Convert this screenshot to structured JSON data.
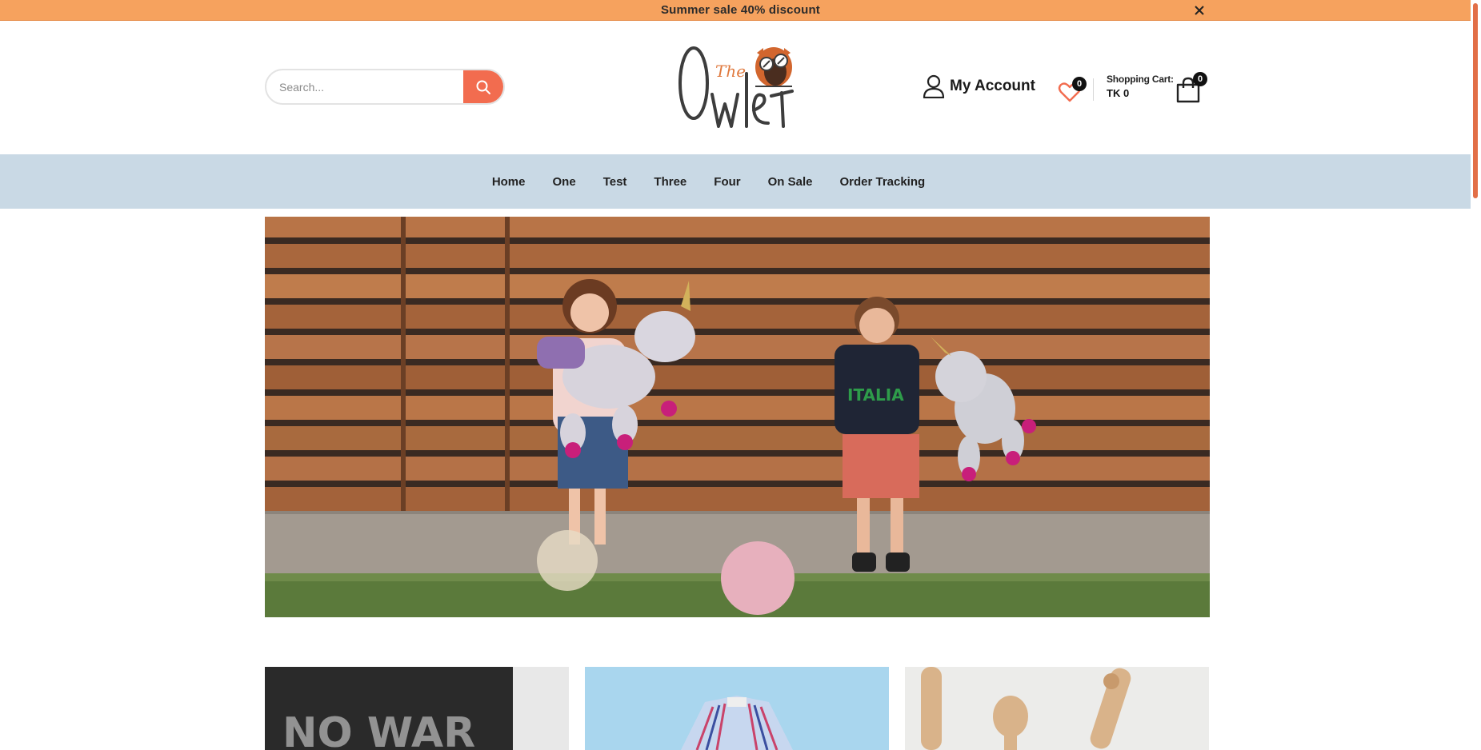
{
  "announcement": {
    "text": "Summer sale 40% discount"
  },
  "header": {
    "search": {
      "placeholder": "Search..."
    },
    "logo": {
      "small_text": "The",
      "main_text": "Owlet"
    },
    "account": {
      "label": "My Account"
    },
    "wishlist": {
      "count": "0"
    },
    "cart": {
      "title": "Shopping Cart:",
      "total": "TK 0",
      "count": "0"
    }
  },
  "nav": {
    "items": [
      {
        "label": "Home"
      },
      {
        "label": "One"
      },
      {
        "label": "Test"
      },
      {
        "label": "Three"
      },
      {
        "label": "Four"
      },
      {
        "label": "On Sale"
      },
      {
        "label": "Order Tracking"
      }
    ]
  },
  "cards": {
    "card1_text": "NO WAR"
  },
  "colors": {
    "announce_bar": "#f6a25e",
    "accent": "#f26c4f",
    "nav_bg": "#c9d9e5"
  }
}
